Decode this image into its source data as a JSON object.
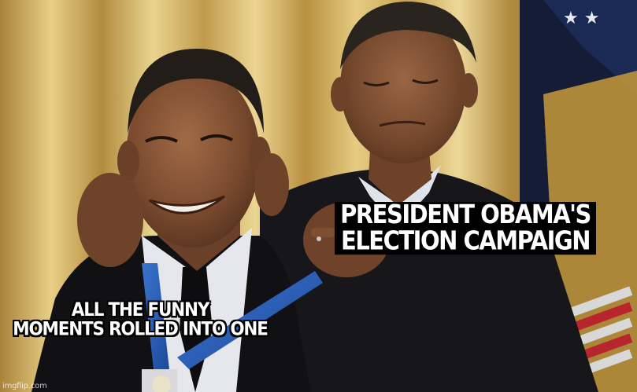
{
  "meme": {
    "caption_right": "PRESIDENT OBAMA'S ELECTION CAMPAIGN",
    "caption_right_line1": "PRESIDENT OBAMA'S",
    "caption_right_line2": "ELECTION CAMPAIGN",
    "caption_left_line1": "ALL THE FUNNY",
    "caption_left_line2": "MOMENTS ROLLED INTO ONE",
    "watermark": "imgflip.com"
  },
  "colors": {
    "curtain_gold": "#c9a24a",
    "caption_text": "#ffffff",
    "caption_box": "#000000",
    "medal_ribbon": "#2a5fb8"
  }
}
